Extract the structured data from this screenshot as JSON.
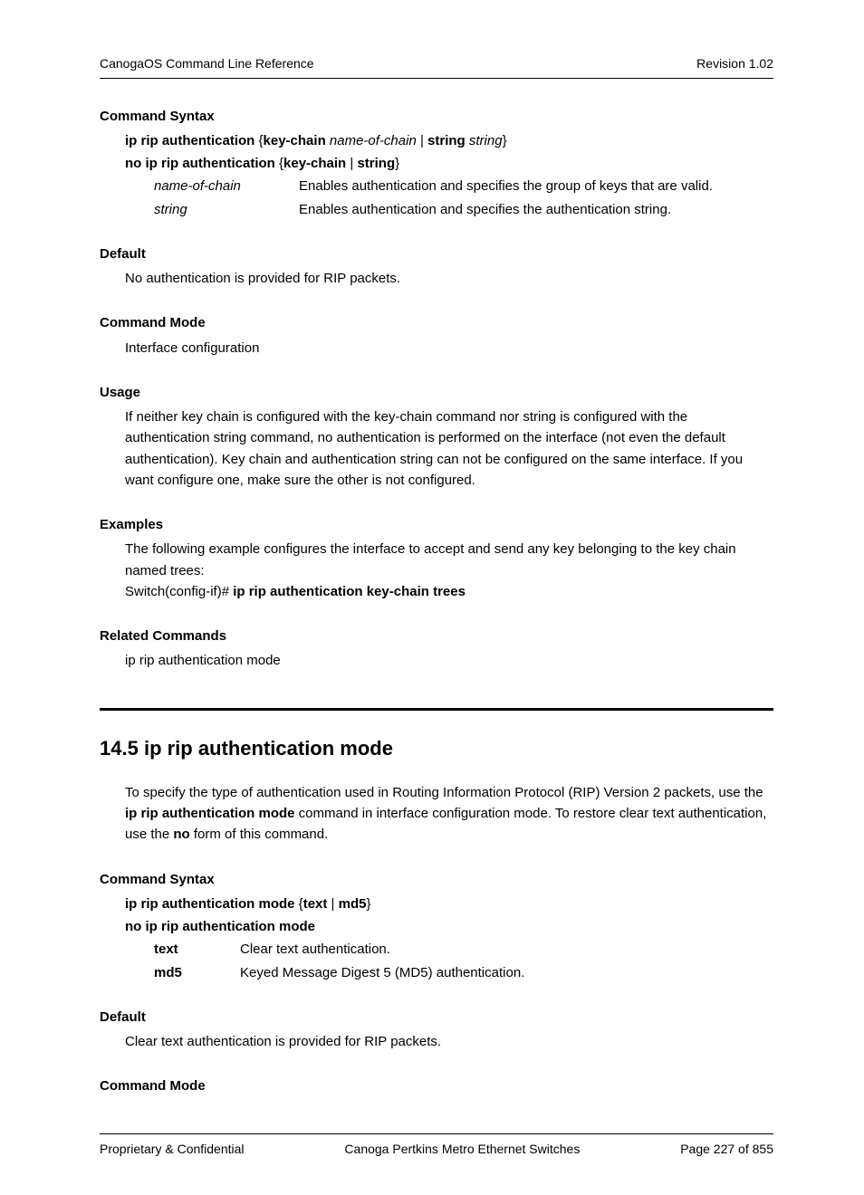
{
  "header": {
    "left": "CanogaOS Command Line Reference",
    "right": "Revision 1.02"
  },
  "s1": {
    "h_syntax": "Command Syntax",
    "syntax1": {
      "a": "ip rip authentication",
      "b": " {",
      "c": "key-chain",
      "d": " name-of-chain",
      "e": " | ",
      "f": "string",
      "g": " string",
      "h": "}"
    },
    "syntax2": {
      "a": "no ip rip authentication",
      "b": " {",
      "c": "key-chain",
      "d": " | ",
      "e": "string",
      "f": "}"
    },
    "params": [
      {
        "name": "name-of-chain",
        "desc": "Enables authentication and specifies the group of keys that are valid."
      },
      {
        "name": "string",
        "desc": "Enables authentication and specifies the authentication string."
      }
    ],
    "h_default": "Default",
    "default_text": "No authentication is provided for RIP packets.",
    "h_mode": "Command Mode",
    "mode_text": "Interface configuration",
    "h_usage": "Usage",
    "usage_text": "If neither key chain is configured with the key-chain command nor string is configured with the authentication string command, no authentication is performed on the interface (not even the default authentication). Key chain and authentication string can not be configured on the same interface. If you want configure one, make sure the other is not configured.",
    "h_examples": "Examples",
    "examples_intro": "The following example configures the interface to accept and send any key belonging to the key chain named trees:",
    "examples_cmd_prefix": "Switch(config-if)# ",
    "examples_cmd_bold": "ip rip authentication key-chain trees",
    "h_related": "Related Commands",
    "related_text": "ip rip authentication mode"
  },
  "s2": {
    "title_num": "14.5",
    "title_text": "ip rip authentication mode",
    "intro_a": "To specify the type of authentication used in Routing Information Protocol (RIP) Version 2 packets, use the ",
    "intro_b": "ip rip authentication mode",
    "intro_c": " command in interface configuration mode. To restore clear text authentication, use the ",
    "intro_d": "no",
    "intro_e": " form of this command.",
    "h_syntax": "Command Syntax",
    "syntax1": {
      "a": "ip rip authentication mode",
      "b": " {",
      "c": "text",
      "d": " | ",
      "e": "md5",
      "f": "}"
    },
    "syntax2": "no ip rip authentication mode",
    "params": [
      {
        "name": "text",
        "desc": "Clear text authentication."
      },
      {
        "name": "md5",
        "desc": "Keyed Message Digest 5 (MD5) authentication."
      }
    ],
    "h_default": "Default",
    "default_text": "Clear text authentication is provided for RIP packets.",
    "h_mode": "Command Mode"
  },
  "footer": {
    "left": "Proprietary & Confidential",
    "center": "Canoga Pertkins Metro Ethernet Switches",
    "right": "Page 227 of 855"
  }
}
